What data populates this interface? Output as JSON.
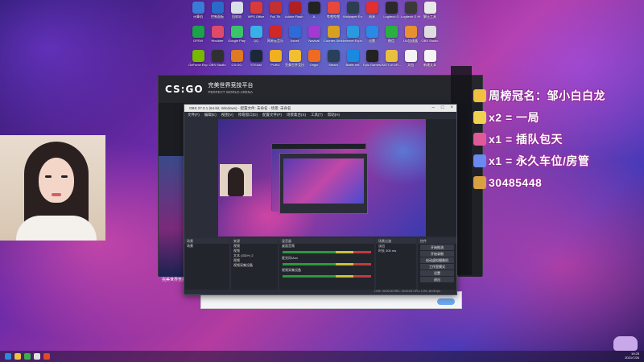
{
  "desktop": {
    "icons": [
      {
        "label": "计算机",
        "color": "#3a7bd5"
      },
      {
        "label": "控制面板",
        "color": "#2a6ac8"
      },
      {
        "label": "回收站",
        "color": "#d9dee8"
      },
      {
        "label": "WPS Office",
        "color": "#d93a3a"
      },
      {
        "label": "Full Tilt",
        "color": "#c23030"
      },
      {
        "label": "Adobe Flash Pla...",
        "color": "#b02020"
      },
      {
        "label": "JL",
        "color": "#222222"
      },
      {
        "label": "哔哩哔哩",
        "color": "#e8483a"
      },
      {
        "label": "Wallpaper Engine",
        "color": "#2c3e50"
      },
      {
        "label": "网易",
        "color": "#e03030"
      },
      {
        "label": "Logitech G",
        "color": "#2a2a2a"
      },
      {
        "label": "Logitech G HUB",
        "color": "#3a3a3a"
      },
      {
        "label": "解压工具",
        "color": "#e8e8e8"
      },
      {
        "label": "",
        "color": "#ffffff00"
      },
      {
        "label": "",
        "color": "#ffffff00"
      },
      {
        "label": "GFEW",
        "color": "#1aa34a"
      },
      {
        "label": "Hbuilder",
        "color": "#e04a6a"
      },
      {
        "label": "Google Play",
        "color": "#3ac46a"
      },
      {
        "label": "QQ",
        "color": "#3ab0e8"
      },
      {
        "label": "网易云音乐",
        "color": "#d02828"
      },
      {
        "label": "Xshell",
        "color": "#2f6bd6"
      },
      {
        "label": "Navicat",
        "color": "#a03ad0"
      },
      {
        "label": "Counter-Strike",
        "color": "#d8a020"
      },
      {
        "label": "Internet Explorer",
        "color": "#2a9ae0"
      },
      {
        "label": "迅雷",
        "color": "#2a8ae8"
      },
      {
        "label": "微信",
        "color": "#2ab040"
      },
      {
        "label": "UU加速器",
        "color": "#e89030"
      },
      {
        "label": "OBS Studio",
        "color": "#dedede"
      },
      {
        "label": "",
        "color": "#ffffff00"
      },
      {
        "label": "",
        "color": "#ffffff00"
      },
      {
        "label": "GeForce Exp",
        "color": "#76b900"
      },
      {
        "label": "OBS Studio",
        "color": "#303030"
      },
      {
        "label": "CS:GO",
        "color": "#e07a20"
      },
      {
        "label": "STEAM",
        "color": "#1b2838"
      },
      {
        "label": "PUBG",
        "color": "#f0b020"
      },
      {
        "label": "完美世界竞技平台",
        "color": "#f0c030"
      },
      {
        "label": "Origin",
        "color": "#f06a20"
      },
      {
        "label": "Steam",
        "color": "#2a3f5a"
      },
      {
        "label": "Battle.net",
        "color": "#1a8ae0"
      },
      {
        "label": "Epic Games",
        "color": "#222222"
      },
      {
        "label": "BATTLEGR...",
        "color": "#e8c040"
      },
      {
        "label": "文档",
        "color": "#f4f4f4"
      },
      {
        "label": "新建文本",
        "color": "#f4f4f4"
      },
      {
        "label": "",
        "color": "#ffffff00"
      },
      {
        "label": "",
        "color": "#ffffff00"
      }
    ]
  },
  "csgo_window": {
    "logo": "CS:GO",
    "title": "完美世界竞技平台",
    "subtitle": "PERFECT WORLD ARENA",
    "art_caption": "完美世界竞技平台"
  },
  "obs": {
    "title": "OBS 27.0.1 (64-bit, Windows) - 配置文件: 未命名 - 场景: 未命名",
    "menu": [
      "文件(F)",
      "编辑(E)",
      "视图(V)",
      "停靠窗口(D)",
      "配置文件(P)",
      "场景集合(S)",
      "工具(T)",
      "帮助(H)"
    ],
    "docks": {
      "scenes": {
        "header": "场景",
        "items": [
          "场景"
        ]
      },
      "sources": {
        "header": "来源",
        "items": [
          "视频",
          "视频",
          "文本 (GDI+) 2",
          "视频",
          "视频采集设备"
        ]
      },
      "mixer": {
        "header": "混音器",
        "items": [
          "桌面音频",
          "麦克风/Aux",
          "视频采集设备"
        ]
      },
      "transitions": {
        "header": "场景过渡",
        "items": [
          "淡出",
          "时长 300 ms"
        ]
      },
      "controls": {
        "header": "控件",
        "buttons": [
          "开始推流",
          "开始录制",
          "启动虚拟摄像机",
          "工作室模式",
          "设置",
          "退出"
        ]
      }
    },
    "status": "LIVE: 00:00:00   REC: 00:00:00   CPU: 2.0%, 60.00 fps"
  },
  "overlay": {
    "rows": [
      {
        "text": "周榜冠名：邹小白白龙",
        "icon": "crown-icon",
        "icon_color": "#f0c040"
      },
      {
        "text": "x2 = 一局",
        "icon": "ticket-icon",
        "icon_color": "#f0d050"
      },
      {
        "text": "x1 = 插队包天",
        "icon": "rocket-icon",
        "icon_color": "#e05a9a"
      },
      {
        "text": "x1 = 永久车位/房管",
        "icon": "rocket-icon",
        "icon_color": "#6a8af0"
      },
      {
        "text": "30485448",
        "icon": "owl-icon",
        "icon_color": "#d8a040"
      }
    ]
  },
  "taskbar": {
    "time": "19:25",
    "date": "2021/7/26"
  }
}
